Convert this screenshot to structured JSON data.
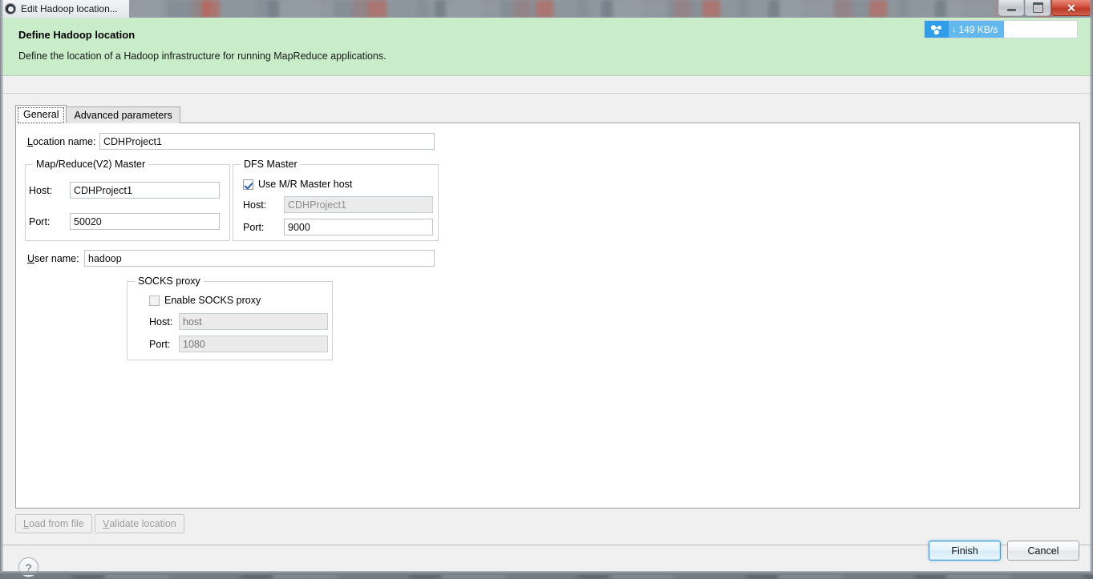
{
  "window": {
    "title": "Edit Hadoop location...",
    "app_icon": "eclipse-gear-icon",
    "minimize_label": "",
    "maximize_label": "",
    "close_label": "✕"
  },
  "speed_widget": {
    "icon": "cloud-share-icon",
    "arrow": "↓",
    "value": "149 KB/s"
  },
  "banner": {
    "title": "Define Hadoop location",
    "description": "Define the location of a Hadoop infrastructure for running MapReduce applications."
  },
  "tabs": [
    {
      "label": "General",
      "selected": true
    },
    {
      "label": "Advanced parameters",
      "selected": false
    }
  ],
  "general": {
    "location_name": {
      "label_mnemonic": "L",
      "label_rest": "ocation name:",
      "value": "CDHProject1"
    },
    "mapreduce_master": {
      "group_title": "Map/Reduce(V2) Master",
      "host_label": "Host:",
      "host_value": "CDHProject1",
      "port_label": "Port:",
      "port_value": "50020"
    },
    "dfs_master": {
      "group_title": "DFS Master",
      "use_mr_master_host_label": "Use M/R Master host",
      "use_mr_master_host_checked": true,
      "host_label": "Host:",
      "host_value": "CDHProject1",
      "host_disabled": true,
      "port_label": "Port:",
      "port_value": "9000"
    },
    "user_name": {
      "label_mnemonic": "U",
      "label_rest": "ser name:",
      "value": "hadoop"
    },
    "socks_proxy": {
      "group_title": "SOCKS proxy",
      "enable_label": "Enable SOCKS proxy",
      "enable_checked": false,
      "host_label": "Host:",
      "host_placeholder": "host",
      "port_label": "Port:",
      "port_placeholder": "1080"
    }
  },
  "panel_buttons": {
    "load_from_file": {
      "mnemonic": "L",
      "rest": "oad from file",
      "enabled": false
    },
    "validate_location": {
      "mnemonic": "V",
      "rest": "alidate location",
      "enabled": false
    }
  },
  "footer": {
    "help_icon": "question-mark-icon",
    "help_glyph": "?",
    "finish_label": "Finish",
    "cancel_label": "Cancel"
  },
  "colors": {
    "banner_green": "#c9ecc9",
    "dialog_grey": "#f0f0f0",
    "default_button_blue": "#3c9ed6",
    "speed_widget_blue": "#2f9ee8",
    "close_button_red": "#d0503c"
  }
}
